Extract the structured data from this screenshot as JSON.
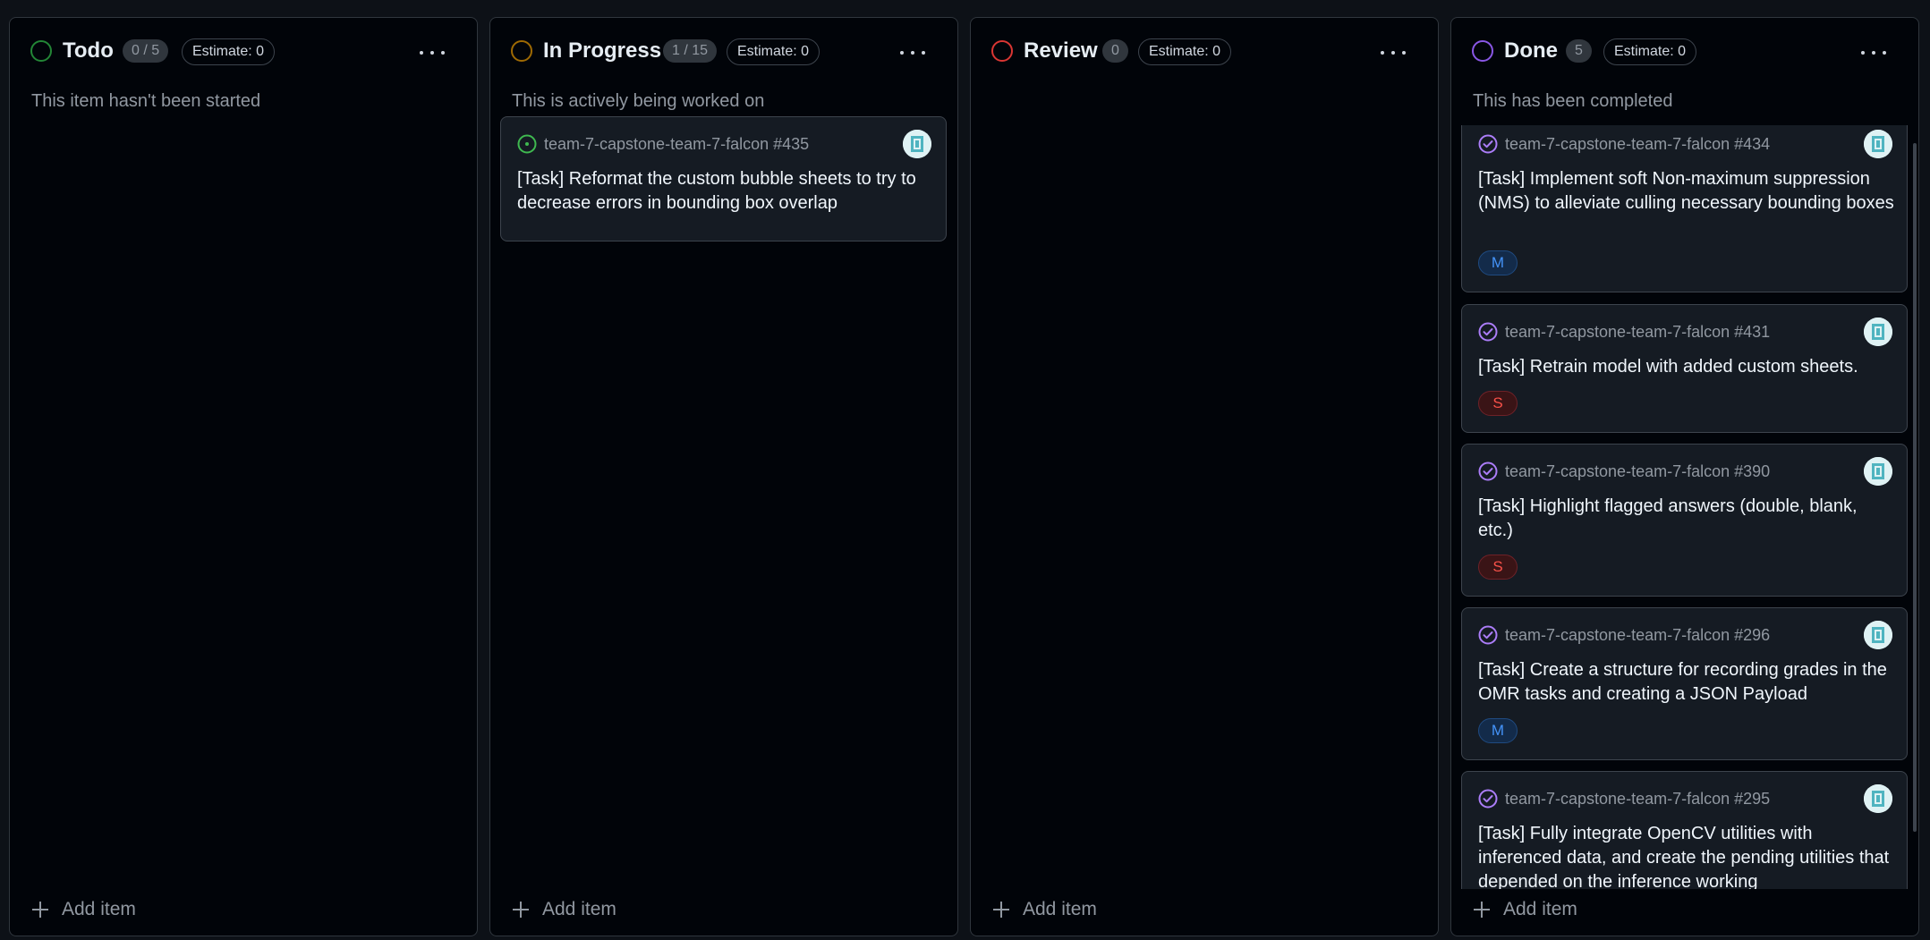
{
  "columns": [
    {
      "title": "Todo",
      "count": "0 / 5",
      "estimate": "Estimate: 0",
      "description": "This item hasn't been started",
      "ring_color": "#238636",
      "add_label": "Add item",
      "cards": []
    },
    {
      "title": "In Progress",
      "count": "1 / 15",
      "estimate": "Estimate: 0",
      "description": "This is actively being worked on",
      "ring_color": "#9e6a03",
      "add_label": "Add item",
      "cards": [
        {
          "repo": "team-7-capstone-team-7-falcon #435",
          "title": "[Task] Reformat the custom bubble sheets to try to decrease errors in bounding box overlap",
          "status": "open-issue-icon",
          "size": ""
        }
      ]
    },
    {
      "title": "Review",
      "count": "0",
      "estimate": "Estimate: 0",
      "description": "",
      "ring_color": "#da3633",
      "add_label": "Add item",
      "cards": []
    },
    {
      "title": "Done",
      "count": "5",
      "estimate": "Estimate: 0",
      "description": "This has been completed",
      "ring_color": "#8957e5",
      "add_label": "Add item",
      "cards": [
        {
          "repo": "team-7-capstone-team-7-falcon #434",
          "title": "[Task] Implement soft Non-maximum suppression (NMS) to alleviate culling necessary bounding boxes",
          "status": "closed-issue-icon",
          "size": "M"
        },
        {
          "repo": "team-7-capstone-team-7-falcon #431",
          "title": "[Task] Retrain model with added custom sheets.",
          "status": "closed-issue-icon",
          "size": "S"
        },
        {
          "repo": "team-7-capstone-team-7-falcon #390",
          "title": "[Task] Highlight flagged answers (double, blank, etc.)",
          "status": "closed-issue-icon",
          "size": "S"
        },
        {
          "repo": "team-7-capstone-team-7-falcon #296",
          "title": "[Task] Create a structure for recording grades in the OMR tasks and creating a JSON Payload",
          "status": "closed-issue-icon",
          "size": "M"
        },
        {
          "repo": "team-7-capstone-team-7-falcon #295",
          "title": "[Task] Fully integrate OpenCV utilities with inferenced data, and create the pending utilities that depended on the inference working",
          "status": "closed-issue-icon",
          "size": ""
        }
      ]
    }
  ],
  "colors": {
    "open_issue": "#3fb950",
    "closed_issue": "#ab7df8"
  }
}
